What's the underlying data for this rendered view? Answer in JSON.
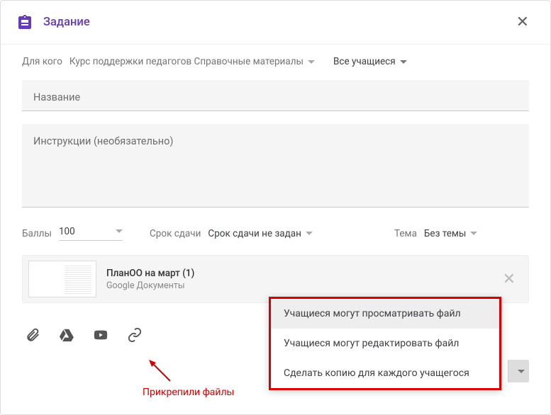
{
  "header": {
    "title": "Задание"
  },
  "audience": {
    "label": "Для кого",
    "course": "Курс поддержки педагогов Справочные материалы",
    "students": "Все учащиеся"
  },
  "fields": {
    "title_placeholder": "Название",
    "instructions_placeholder": "Инструкции (необязательно)"
  },
  "meta": {
    "points_label": "Баллы",
    "points_value": "100",
    "due_label": "Срок сдачи",
    "due_value": "Срок сдачи не задан",
    "topic_label": "Тема",
    "topic_value": "Без темы"
  },
  "attachment": {
    "title": "ПланОО на март (1)",
    "subtitle": "Google Документы"
  },
  "dropdown": {
    "items": [
      "Учащиеся могут просматривать файл",
      "Учащиеся могут редактировать файл",
      "Сделать копию для каждого учащегося"
    ]
  },
  "annotation": "Прикрепили файлы"
}
